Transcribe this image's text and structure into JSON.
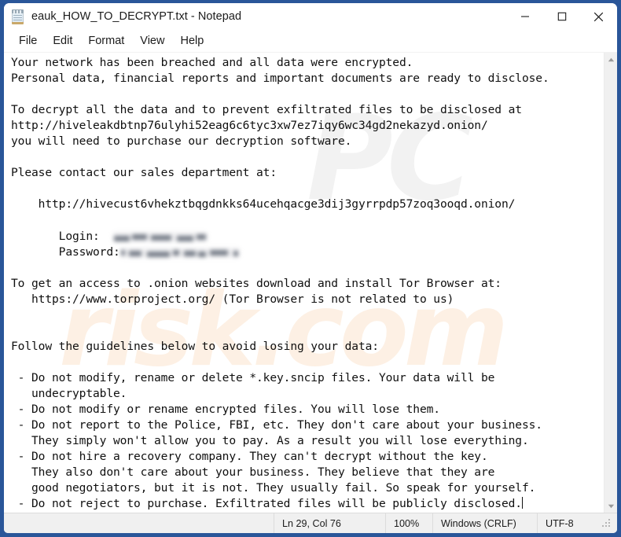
{
  "window": {
    "title": "eauk_HOW_TO_DECRYPT.txt - Notepad",
    "icon": "notepad-icon",
    "border_color": "#2a5699",
    "controls": {
      "minimize": "minimize-icon",
      "maximize": "maximize-icon",
      "close": "close-icon"
    }
  },
  "menubar": {
    "items": [
      {
        "label": "File"
      },
      {
        "label": "Edit"
      },
      {
        "label": "Format"
      },
      {
        "label": "View"
      },
      {
        "label": "Help"
      }
    ]
  },
  "document": {
    "lines": [
      "Your network has been breached and all data were encrypted.",
      "Personal data, financial reports and important documents are ready to disclose.",
      "",
      "To decrypt all the data and to prevent exfiltrated files to be disclosed at",
      "http://hiveleakdbtnp76ulyhi52eag6c6tyc3xw7ez7iqy6wc34gd2nekazyd.onion/",
      "you will need to purchase our decryption software.",
      "",
      "Please contact our sales department at:",
      "",
      "    http://hivecust6vhekztbqgdnkks64ucehqacge3dij3gyrrpdp57zoq3ooqd.onion/",
      "",
      "       Login:",
      "       Password:",
      "",
      "To get an access to .onion websites download and install Tor Browser at:",
      "   https://www.torproject.org/ (Tor Browser is not related to us)",
      "",
      "",
      "Follow the guidelines below to avoid losing your data:",
      "",
      " - Do not modify, rename or delete *.key.sncip files. Your data will be",
      "   undecryptable.",
      " - Do not modify or rename encrypted files. You will lose them.",
      " - Do not report to the Police, FBI, etc. They don't care about your business.",
      "   They simply won't allow you to pay. As a result you will lose everything.",
      " - Do not hire a recovery company. They can't decrypt without the key.",
      "   They also don't care about your business. They believe that they are",
      "   good negotiators, but it is not. They usually fail. So speak for yourself.",
      " - Do not reject to purchase. Exfiltrated files will be publicly disclosed."
    ],
    "redacted_fields": [
      {
        "label": "Login:",
        "value": "",
        "state": "blurred"
      },
      {
        "label": "Password:",
        "value": "",
        "state": "blurred"
      }
    ],
    "watermarks": [
      {
        "text": "PC",
        "color": "#f2f2f2"
      },
      {
        "text": "risk.com",
        "color": "#fdf0e4"
      }
    ]
  },
  "scrollbar": {
    "up_arrow": "scroll-up-icon",
    "down_arrow": "scroll-down-icon"
  },
  "statusbar": {
    "position": "Ln 29, Col 76",
    "zoom": "100%",
    "line_ending": "Windows (CRLF)",
    "encoding": "UTF-8"
  }
}
